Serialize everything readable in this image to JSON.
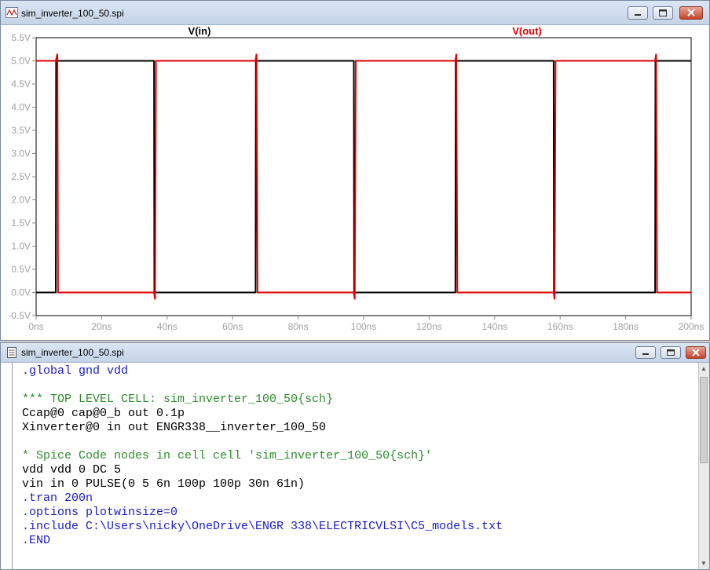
{
  "plot_window": {
    "title": "sim_inverter_100_50.spi",
    "icon": "waveform-icon"
  },
  "editor_window": {
    "title": "sim_inverter_100_50.spi",
    "icon": "document-icon",
    "lines": [
      {
        "text": ".global gnd vdd",
        "kind": "directive"
      },
      {
        "text": "",
        "kind": "blank"
      },
      {
        "text": "*** TOP LEVEL CELL: sim_inverter_100_50{sch}",
        "kind": "comment"
      },
      {
        "text": "Ccap@0 cap@0_b out 0.1p",
        "kind": "element"
      },
      {
        "text": "Xinverter@0 in out ENGR338__inverter_100_50",
        "kind": "element"
      },
      {
        "text": "",
        "kind": "blank"
      },
      {
        "text": "* Spice Code nodes in cell cell 'sim_inverter_100_50{sch}'",
        "kind": "comment"
      },
      {
        "text": "vdd vdd 0 DC 5",
        "kind": "element"
      },
      {
        "text": "vin in 0 PULSE(0 5 6n 100p 100p 30n 61n)",
        "kind": "element"
      },
      {
        "text": ".tran 200n",
        "kind": "directive"
      },
      {
        "text": ".options plotwinsize=0",
        "kind": "directive"
      },
      {
        "text": ".include C:\\Users\\nicky\\OneDrive\\ENGR 338\\ELECTRICVLSI\\C5_models.txt",
        "kind": "directive"
      },
      {
        "text": ".END",
        "kind": "directive"
      }
    ]
  },
  "chart_data": {
    "type": "line",
    "xlabel": "",
    "ylabel": "",
    "xlim": [
      0,
      200
    ],
    "ylim": [
      -0.5,
      5.5
    ],
    "x_unit": "ns",
    "x_ticks": [
      "0ns",
      "20ns",
      "40ns",
      "60ns",
      "80ns",
      "100ns",
      "120ns",
      "140ns",
      "160ns",
      "180ns",
      "200ns"
    ],
    "y_ticks": [
      "5.5V",
      "5.0V",
      "4.5V",
      "4.0V",
      "3.5V",
      "3.0V",
      "2.5V",
      "2.0V",
      "1.5V",
      "1.0V",
      "0.5V",
      "0.0V",
      "-0.5V"
    ],
    "grid": false,
    "series": [
      {
        "name": "V(in)",
        "color": "#000000",
        "points": [
          [
            0,
            0
          ],
          [
            6,
            0
          ],
          [
            6.1,
            5
          ],
          [
            36,
            5
          ],
          [
            36.1,
            0
          ],
          [
            67,
            0
          ],
          [
            67.1,
            5
          ],
          [
            97,
            5
          ],
          [
            97.1,
            0
          ],
          [
            128,
            0
          ],
          [
            128.1,
            5
          ],
          [
            158,
            5
          ],
          [
            158.1,
            0
          ],
          [
            189,
            0
          ],
          [
            189.1,
            5
          ],
          [
            200,
            5
          ]
        ]
      },
      {
        "name": "V(out)",
        "color": "#e00000",
        "points": [
          [
            0,
            5
          ],
          [
            6,
            5
          ],
          [
            6.5,
            5.15
          ],
          [
            6.7,
            0
          ],
          [
            36,
            0
          ],
          [
            36.3,
            -0.15
          ],
          [
            36.6,
            5
          ],
          [
            67,
            5
          ],
          [
            67.3,
            5.15
          ],
          [
            67.6,
            0
          ],
          [
            97,
            0
          ],
          [
            97.3,
            -0.15
          ],
          [
            97.6,
            5
          ],
          [
            128,
            5
          ],
          [
            128.3,
            5.15
          ],
          [
            128.6,
            0
          ],
          [
            158,
            0
          ],
          [
            158.3,
            -0.15
          ],
          [
            158.6,
            5
          ],
          [
            189,
            5
          ],
          [
            189.3,
            5.15
          ],
          [
            189.6,
            0
          ],
          [
            200,
            0
          ]
        ]
      }
    ]
  }
}
